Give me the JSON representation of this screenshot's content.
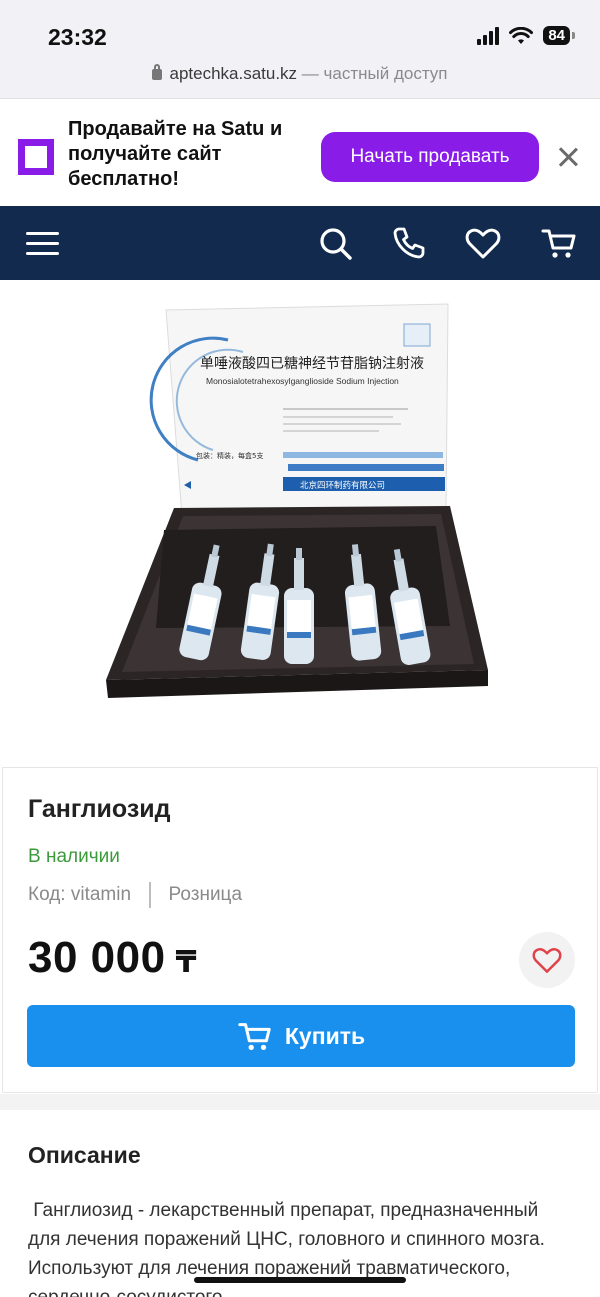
{
  "status_bar": {
    "time": "23:32",
    "battery": "84",
    "url": "aptechka.satu.kz",
    "url_note": "— частный доступ"
  },
  "promo": {
    "text": "Продавайте на Satu и получайте сайт бесплатно!",
    "button_label": "Начать продавать",
    "accent_color": "#8a1ce8"
  },
  "nav": {
    "background_color": "#112a4d",
    "icons": [
      "menu-icon",
      "search-icon",
      "phone-icon",
      "heart-icon",
      "cart-icon"
    ]
  },
  "product": {
    "image_text": {
      "box_title_cn": "单唾液酸四已糖神经节苷脂钠注射液",
      "box_title_en": "Monosialotetrahexosylganglioside Sodium Injection",
      "box_manufacturer_cn": "北京四环制药有限公司",
      "box_package_cn": "包装：精装，每盒5支"
    },
    "title": "Ганглиозид",
    "stock": "В наличии",
    "code": "Код: vitamin",
    "sale_type": "Розница",
    "price": "30 000",
    "currency": "₸",
    "buy_label": "Купить",
    "buy_color": "#1a90ee"
  },
  "description": {
    "heading": "Описание",
    "text": " Ганглиозид - лекарственный препарат, предназначенный для лечения поражений ЦНС, головного и спинного мозга. Используют для лечения поражений травматического, сердечно-сосудистого"
  }
}
